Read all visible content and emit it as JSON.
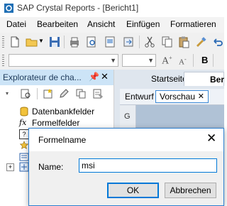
{
  "window": {
    "title": "SAP Crystal Reports - [Bericht1]"
  },
  "menu": {
    "items": [
      "Datei",
      "Bearbeiten",
      "Ansicht",
      "Einfügen",
      "Formatieren"
    ]
  },
  "toolbar2": {
    "font_size_glyph": "A",
    "bold": "B"
  },
  "explorer": {
    "title": "Explorateur de cha...",
    "items": [
      {
        "label": "Datenbankfelder",
        "icon": "database-icon"
      },
      {
        "label": "Formelfelder",
        "icon": "formula-fx-icon"
      }
    ]
  },
  "doc": {
    "tabs": [
      "Startseite",
      "Ber"
    ],
    "view_tabs": [
      "Entwurf",
      "Vorschau"
    ],
    "ruler_letter": "G"
  },
  "dialog": {
    "title": "Formelname",
    "name_label": "Name:",
    "name_value": "msi",
    "ok_label": "OK",
    "cancel_label": "Abbrechen"
  },
  "colors": {
    "accent": "#0078d7",
    "panel_header": "#cce4f7",
    "doc_background": "#dfe6ee"
  }
}
